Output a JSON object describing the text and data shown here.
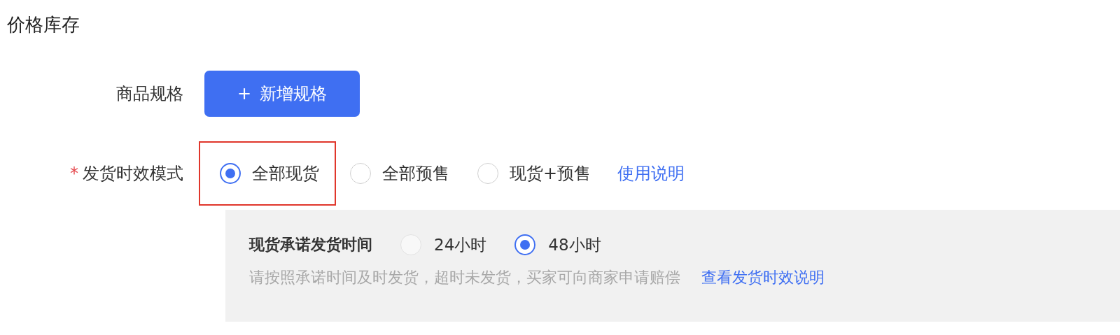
{
  "section_title": "价格库存",
  "spec": {
    "label": "商品规格",
    "button": {
      "icon": "+",
      "label": "新增规格"
    }
  },
  "delivery_mode": {
    "required_mark": "*",
    "label": "发货时效模式",
    "options": [
      {
        "label": "全部现货",
        "selected": true,
        "highlighted": true
      },
      {
        "label": "全部预售",
        "selected": false,
        "highlighted": false
      },
      {
        "label": "现货+预售",
        "selected": false,
        "highlighted": false
      }
    ],
    "help_link": "使用说明"
  },
  "promise_panel": {
    "label": "现货承诺发货时间",
    "options": [
      {
        "label": "24小时",
        "selected": false
      },
      {
        "label": "48小时",
        "selected": true
      }
    ],
    "note": "请按照承诺时间及时发货，超时未发货，买家可向商家申请赔偿",
    "note_link": "查看发货时效说明"
  }
}
